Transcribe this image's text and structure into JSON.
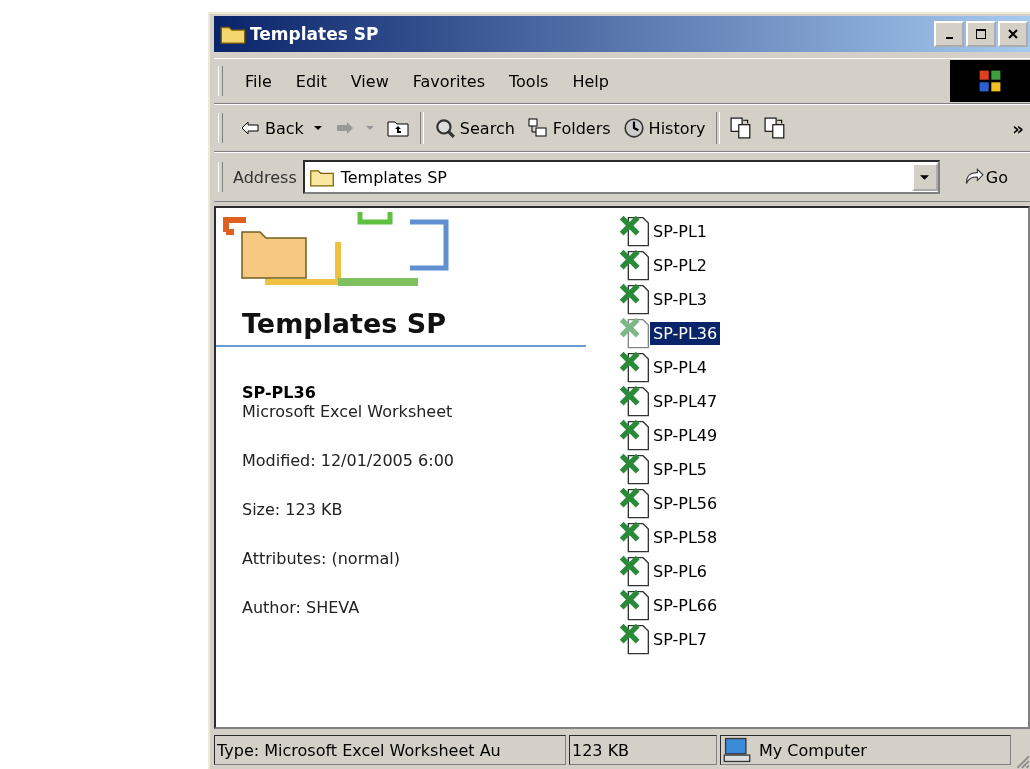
{
  "window": {
    "title": "Templates SP"
  },
  "menu": [
    "File",
    "Edit",
    "View",
    "Favorites",
    "Tools",
    "Help"
  ],
  "toolbar": [
    {
      "kind": "back",
      "label": "Back"
    },
    {
      "kind": "forward"
    },
    {
      "kind": "up"
    },
    {
      "kind": "search",
      "label": "Search"
    },
    {
      "kind": "folders",
      "label": "Folders"
    },
    {
      "kind": "history",
      "label": "History"
    },
    {
      "kind": "move"
    },
    {
      "kind": "copy"
    }
  ],
  "toolbar_more": "»",
  "address": {
    "label": "Address",
    "value": "Templates SP",
    "go": "Go"
  },
  "info": {
    "heading": "Templates SP",
    "file_name": "SP-PL36",
    "file_type": "Microsoft Excel Worksheet",
    "details": [
      "Modified: 12/01/2005 6:00",
      "Size: 123 KB",
      "Attributes: (normal)",
      "Author: SHEVA"
    ]
  },
  "files": [
    {
      "name": "SP-PL1",
      "selected": false
    },
    {
      "name": "SP-PL2",
      "selected": false
    },
    {
      "name": "SP-PL3",
      "selected": false
    },
    {
      "name": "SP-PL36",
      "selected": true
    },
    {
      "name": "SP-PL4",
      "selected": false
    },
    {
      "name": "SP-PL47",
      "selected": false
    },
    {
      "name": "SP-PL49",
      "selected": false
    },
    {
      "name": "SP-PL5",
      "selected": false
    },
    {
      "name": "SP-PL56",
      "selected": false
    },
    {
      "name": "SP-PL58",
      "selected": false
    },
    {
      "name": "SP-PL6",
      "selected": false
    },
    {
      "name": "SP-PL66",
      "selected": false
    },
    {
      "name": "SP-PL7",
      "selected": false
    }
  ],
  "status_bar": {
    "type": "Type: Microsoft Excel Worksheet Au",
    "size": "123 KB",
    "zone": "My Computer"
  }
}
